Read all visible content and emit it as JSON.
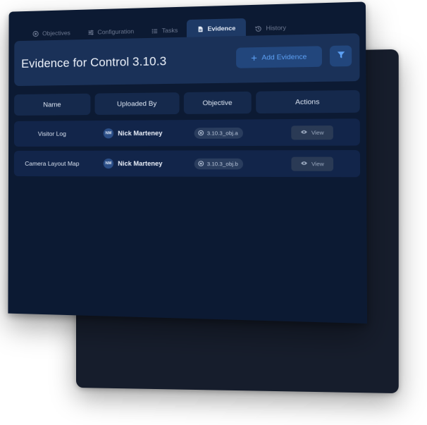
{
  "tabs": [
    {
      "label": "Objectives",
      "icon": "target-icon",
      "active": false
    },
    {
      "label": "Configuration",
      "icon": "sliders-icon",
      "active": false
    },
    {
      "label": "Tasks",
      "icon": "list-icon",
      "active": false
    },
    {
      "label": "Evidence",
      "icon": "document-icon",
      "active": true
    },
    {
      "label": "History",
      "icon": "history-icon",
      "active": false
    }
  ],
  "header": {
    "title": "Evidence for Control 3.10.3",
    "add_label": "Add Evidence",
    "filter_icon": "filter-icon"
  },
  "table": {
    "columns": [
      "Name",
      "Uploaded By",
      "Objective",
      "Actions"
    ],
    "rows": [
      {
        "name": "Visitor Log",
        "uploader_initials": "NM",
        "uploader": "Nick Marteney",
        "objective": "3.10.3_obj.a",
        "action": "View"
      },
      {
        "name": "Camera Layout Map",
        "uploader_initials": "NM",
        "uploader": "Nick Marteney",
        "objective": "3.10.3_obj.b",
        "action": "View"
      }
    ]
  },
  "colors": {
    "panel_bg": "#0c1a33",
    "header_bg": "#1a3158",
    "accent": "#5da1f5",
    "active_tab": "#1e3a66"
  }
}
